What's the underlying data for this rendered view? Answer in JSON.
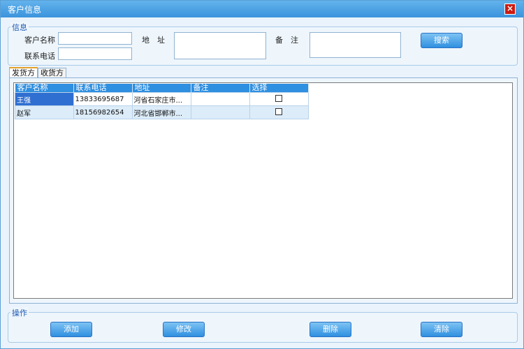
{
  "window": {
    "title": "客户信息",
    "close": "×"
  },
  "info": {
    "legend": "信息",
    "name_label": "客户名称",
    "phone_label": "联系电话",
    "address_label": "地　址",
    "remark_label": "备　注",
    "search_label": "搜索",
    "name_value": "",
    "phone_value": "",
    "address_value": "",
    "remark_value": ""
  },
  "tabs": [
    {
      "label": "发货方"
    },
    {
      "label": "收货方"
    }
  ],
  "table": {
    "headers": [
      "客户名称",
      "联系电话",
      "地址",
      "备注",
      "选择"
    ],
    "rows": [
      {
        "name": "王强",
        "phone": "13833695687",
        "address": "河省石家庄市...",
        "remark": ""
      },
      {
        "name": "赵军",
        "phone": "18156982654",
        "address": "河北省邯郸市...",
        "remark": ""
      }
    ]
  },
  "ops": {
    "legend": "操作",
    "add": "添加",
    "edit": "修改",
    "delete": "删除",
    "clear": "清除"
  },
  "colors": {
    "accent": "#2f8fe0",
    "title_bar": "#4aa0e4",
    "close": "#cc1a10"
  }
}
